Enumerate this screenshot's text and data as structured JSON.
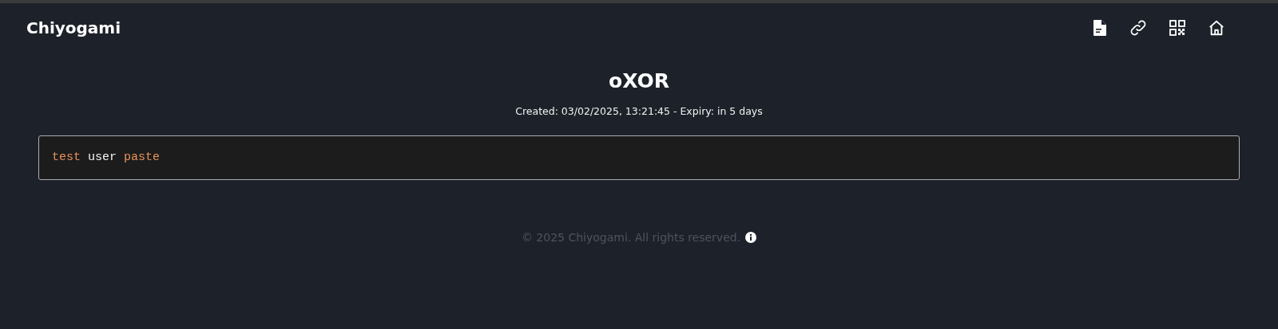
{
  "header": {
    "brand": "Chiyogami",
    "actions": [
      {
        "kind": "file"
      },
      {
        "kind": "link"
      },
      {
        "kind": "qr"
      },
      {
        "kind": "home"
      }
    ]
  },
  "paste": {
    "title": "oXOR",
    "meta": "Created: 03/02/2025, 13:21:45 - Expiry: in 5 days",
    "code": [
      {
        "text": "test",
        "kind": "keyword"
      },
      {
        "text": "user",
        "kind": "plain"
      },
      {
        "text": "paste",
        "kind": "keyword"
      }
    ]
  },
  "footer": {
    "text": "© 2025 Chiyogami. All rights reserved."
  }
}
